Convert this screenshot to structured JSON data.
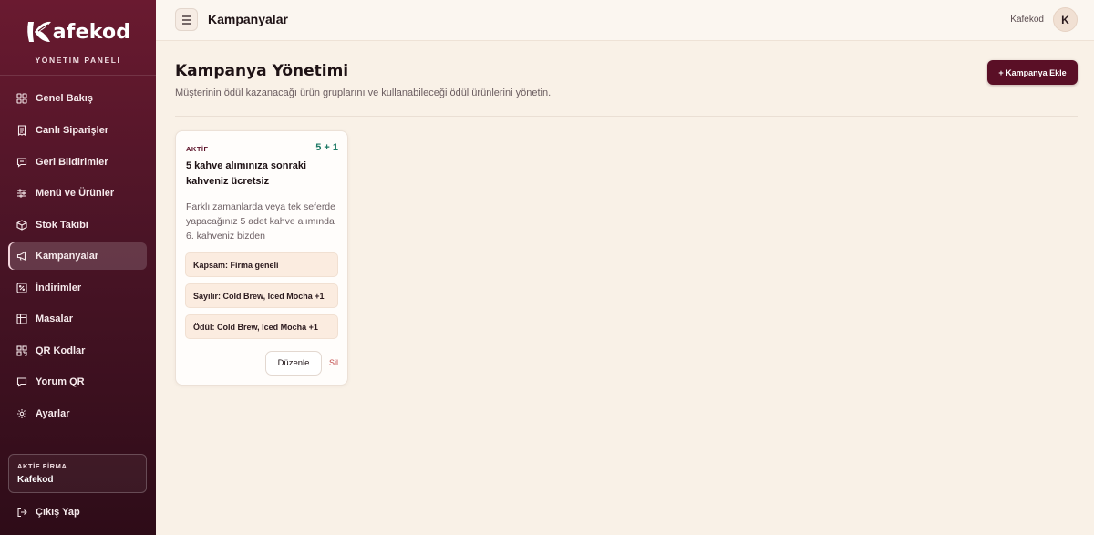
{
  "sidebar": {
    "brand": "afekod",
    "subtitle": "YÖNETİM PANELİ",
    "items": [
      {
        "label": "Genel Bakış",
        "icon": "grid-icon"
      },
      {
        "label": "Canlı Siparişler",
        "icon": "receipt-icon"
      },
      {
        "label": "Geri Bildirimler",
        "icon": "message-icon"
      },
      {
        "label": "Menü ve Ürünler",
        "icon": "sliders-icon"
      },
      {
        "label": "Stok Takibi",
        "icon": "box-icon"
      },
      {
        "label": "Kampanyalar",
        "icon": "megaphone-icon"
      },
      {
        "label": "İndirimler",
        "icon": "discount-icon"
      },
      {
        "label": "Masalar",
        "icon": "table-icon"
      },
      {
        "label": "QR Kodlar",
        "icon": "qr-icon"
      },
      {
        "label": "Yorum QR",
        "icon": "comment-icon"
      },
      {
        "label": "Ayarlar",
        "icon": "gear-icon"
      }
    ],
    "active_index": 5,
    "firm_label": "AKTİF FİRMA",
    "firm_name": "Kafekod",
    "logout_label": "Çıkış Yap"
  },
  "topbar": {
    "title": "Kampanyalar",
    "user_name": "Kafekod",
    "avatar_initial": "K"
  },
  "main": {
    "title": "Kampanya Yönetimi",
    "description": "Müşterinin ödül kazanacağı ürün gruplarını ve kullanabileceği ödül ürünlerini yönetin.",
    "add_button": "+ Kampanya Ekle"
  },
  "campaign": {
    "status": "AKTİF",
    "badge": "5 + 1",
    "title": "5 kahve alımınıza sonraki kahveniz ücretsiz",
    "description": "Farklı zamanlarda veya tek seferde yapacağınız 5 adet kahve alımında 6. kahveniz bizden",
    "scope": "Kapsam: Firma geneli",
    "counted": "Sayılır: Cold Brew, Iced Mocha +1",
    "reward": "Ödül: Cold Brew, Iced Mocha +1",
    "edit_label": "Düzenle",
    "delete_label": "Sil"
  },
  "colors": {
    "sidebar": "#4a1426",
    "accent": "#5a0f26",
    "badge": "#1f7a66",
    "background": "#f9f1e7"
  }
}
